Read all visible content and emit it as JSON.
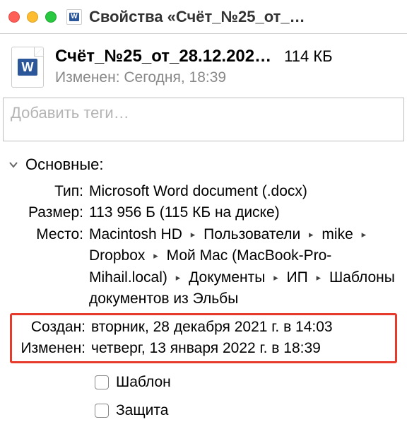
{
  "window": {
    "title": "Свойства «Счёт_№25_от_…"
  },
  "header": {
    "file_name": "Счёт_№25_от_28.12.202…",
    "file_size": "114 КБ",
    "modified_label": "Изменен:",
    "modified_value": "Сегодня, 18:39"
  },
  "tags": {
    "placeholder": "Добавить теги…"
  },
  "section": {
    "title": "Основные:"
  },
  "details": {
    "type_label": "Тип:",
    "type_value": "Microsoft Word document (.docx)",
    "size_label": "Размер:",
    "size_value": "113 956 Б (115 КБ на диске)",
    "where_label": "Место:",
    "path_segments": [
      "Macintosh HD",
      "Пользователи",
      "mike",
      "Dropbox",
      "Мой Mac (MacBook-Pro-Mihail.local)",
      "Документы",
      "ИП",
      "Шаблоны документов из Эльбы"
    ],
    "created_label": "Создан:",
    "created_value": "вторник, 28 декабря 2021 г. в 14:03",
    "modified_label": "Изменен:",
    "modified_value": "четверг, 13 января 2022 г. в 18:39"
  },
  "checks": {
    "stationery": "Шаблон",
    "locked": "Защита"
  }
}
